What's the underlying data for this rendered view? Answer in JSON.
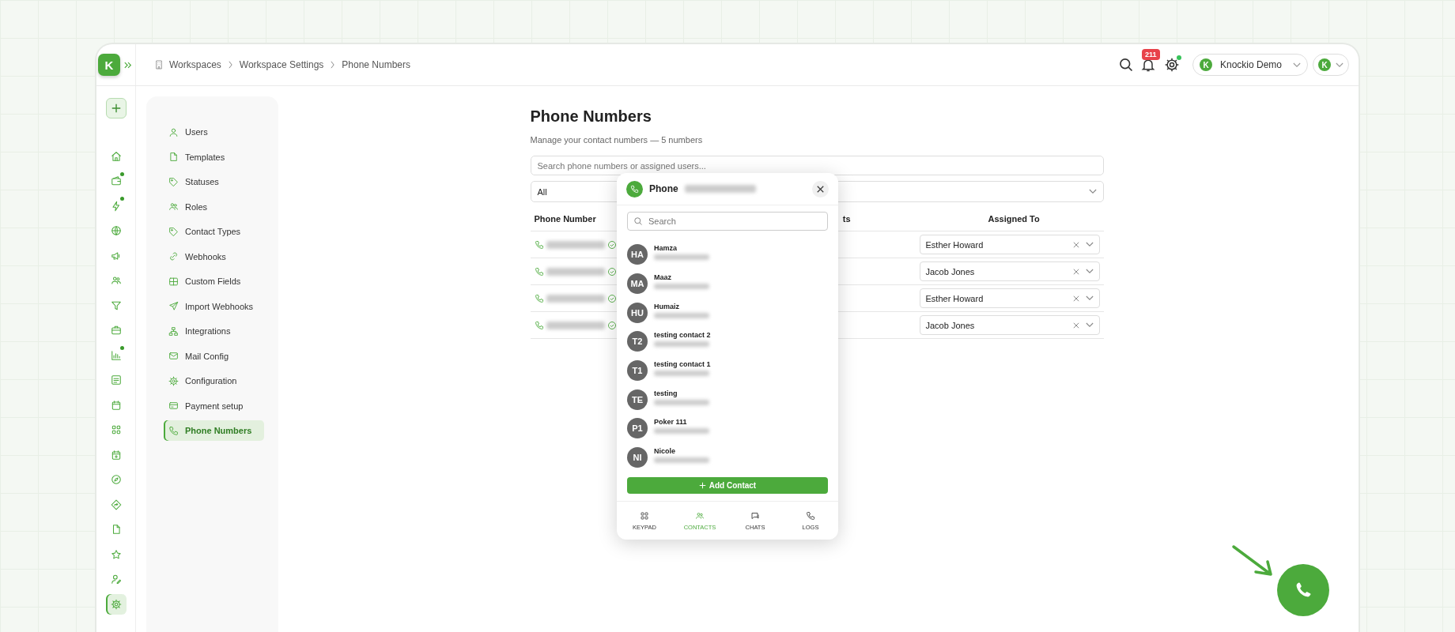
{
  "topbar": {
    "brand_logo": "K",
    "breadcrumbs": [
      {
        "label": "Workspaces"
      },
      {
        "label": "Workspace Settings"
      },
      {
        "label": "Phone Numbers"
      }
    ],
    "notification_count": "211",
    "settings_dot": true,
    "workspace_logo": "K",
    "workspace": "Knockio Demo",
    "account_logo": "K"
  },
  "rail": [
    {
      "kind": "home",
      "dot": false,
      "selected": false
    },
    {
      "kind": "wallet",
      "dot": true,
      "selected": false
    },
    {
      "kind": "bolt",
      "dot": true,
      "selected": false
    },
    {
      "kind": "globe",
      "dot": false,
      "selected": false
    },
    {
      "kind": "megaphone",
      "dot": false,
      "selected": false
    },
    {
      "kind": "people",
      "dot": false,
      "selected": false
    },
    {
      "kind": "filter",
      "dot": false,
      "selected": false
    },
    {
      "kind": "briefcase",
      "dot": false,
      "selected": false
    },
    {
      "kind": "chart",
      "dot": true,
      "selected": false
    },
    {
      "kind": "task",
      "dot": false,
      "selected": false
    },
    {
      "kind": "calendar",
      "dot": false,
      "selected": false
    },
    {
      "kind": "grid",
      "dot": false,
      "selected": false
    },
    {
      "kind": "calendar-plus",
      "dot": false,
      "selected": false
    },
    {
      "kind": "compass",
      "dot": false,
      "selected": false
    },
    {
      "kind": "diamond-arrow",
      "dot": false,
      "selected": false
    },
    {
      "kind": "document",
      "dot": false,
      "selected": false
    },
    {
      "kind": "star",
      "dot": false,
      "selected": false
    },
    {
      "kind": "user-pen",
      "dot": false,
      "selected": false
    },
    {
      "kind": "gear",
      "dot": false,
      "selected": true
    }
  ],
  "settings_nav": [
    {
      "label": "Users",
      "selected": false
    },
    {
      "label": "Templates",
      "selected": false
    },
    {
      "label": "Statuses",
      "selected": false
    },
    {
      "label": "Roles",
      "selected": false
    },
    {
      "label": "Contact Types",
      "selected": false
    },
    {
      "label": "Webhooks",
      "selected": false
    },
    {
      "label": "Custom Fields",
      "selected": false
    },
    {
      "label": "Import Webhooks",
      "selected": false
    },
    {
      "label": "Integrations",
      "selected": false
    },
    {
      "label": "Mail Config",
      "selected": false
    },
    {
      "label": "Configuration",
      "selected": false
    },
    {
      "label": "Payment setup",
      "selected": false
    },
    {
      "label": "Phone Numbers",
      "selected": true
    }
  ],
  "page": {
    "title": "Phone Numbers",
    "subtitle": "Manage your contact numbers — 5 numbers",
    "search_placeholder": "Search phone numbers or assigned users...",
    "filter": "All",
    "table": {
      "columns": [
        {
          "label": "Phone Number"
        },
        {
          "label": "ts"
        },
        {
          "label": "Assigned To"
        }
      ],
      "rows": [
        {
          "assigned_to": "Esther Howard"
        },
        {
          "assigned_to": "Jacob Jones"
        },
        {
          "assigned_to": "Esther Howard"
        },
        {
          "assigned_to": "Jacob Jones"
        }
      ]
    }
  },
  "dialer": {
    "title": "Phone",
    "search_placeholder": "Search",
    "contacts": [
      {
        "initials": "HA",
        "name": "Hamza"
      },
      {
        "initials": "MA",
        "name": "Maaz"
      },
      {
        "initials": "HU",
        "name": "Humaiz"
      },
      {
        "initials": "T2",
        "name": "testing contact 2"
      },
      {
        "initials": "T1",
        "name": "testing contact 1"
      },
      {
        "initials": "TE",
        "name": "testing"
      },
      {
        "initials": "P1",
        "name": "Poker 111"
      },
      {
        "initials": "NI",
        "name": "Nicole"
      }
    ],
    "add_button": "Add Contact",
    "tabs": [
      {
        "label": "KEYPAD",
        "selected": false
      },
      {
        "label": "CONTACTS",
        "selected": true
      },
      {
        "label": "CHATS",
        "selected": false
      },
      {
        "label": "LOGS",
        "selected": false
      }
    ]
  }
}
